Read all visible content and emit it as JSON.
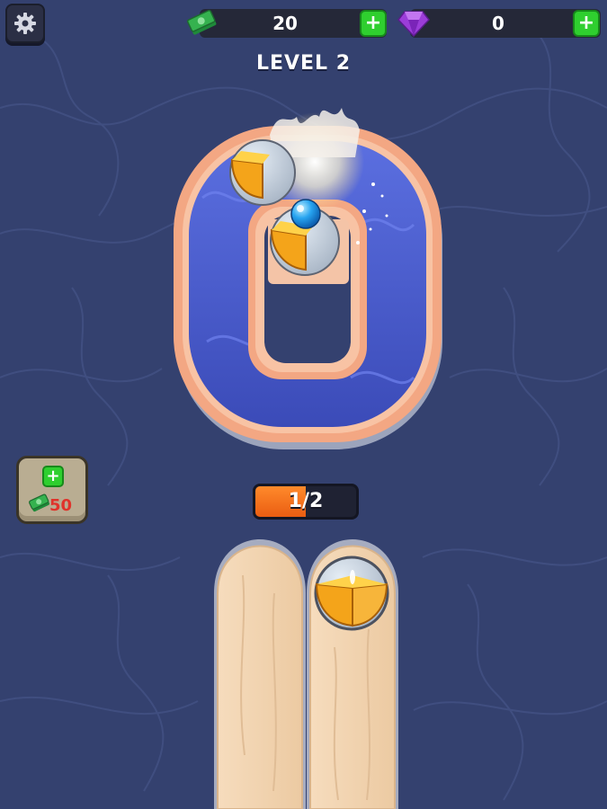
{
  "hud": {
    "cash": "20",
    "gems": "0",
    "level_title": "LEVEL 2",
    "booster_price": "50",
    "progress_text": "1/2",
    "progress_fraction": 0.5
  },
  "icons": {
    "settings": "gear-icon",
    "cash": "cash-stack-icon",
    "gem": "purple-gem-icon",
    "add": "plus-icon"
  },
  "colors": {
    "accent_green": "#2fcf2f",
    "progress_orange": "#ea5d12",
    "price_red": "#e0332b",
    "gem_purple": "#9b3dd8",
    "background": "#33406f",
    "track_water": "#4658c9",
    "track_rim": "#f3a783",
    "wood": "#f3d7b5"
  }
}
